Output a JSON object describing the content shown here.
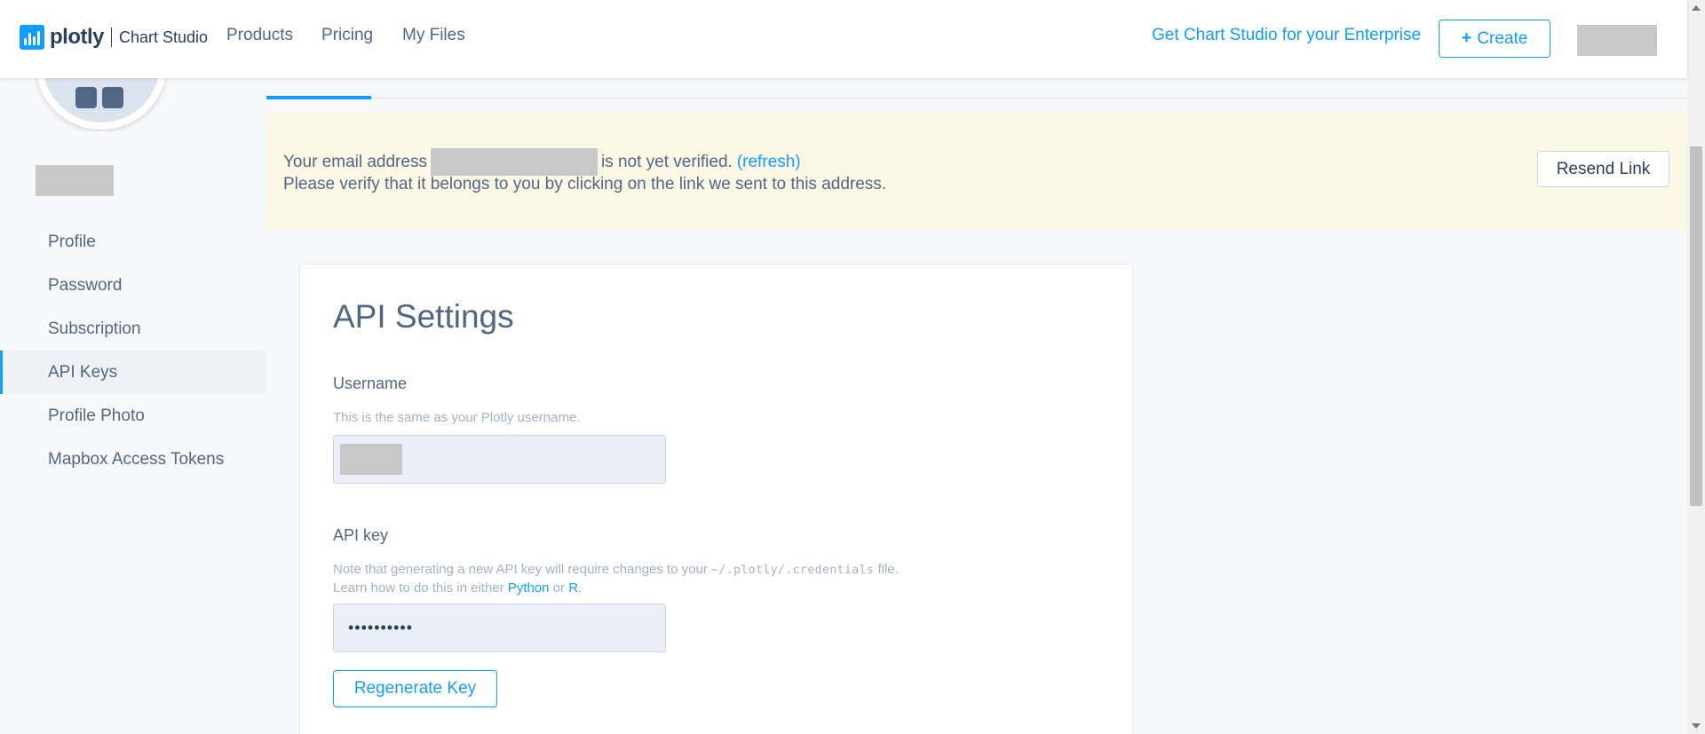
{
  "nav": {
    "logo_text": "plotly",
    "logo_sub": "Chart Studio",
    "links": [
      "Products",
      "Pricing",
      "My Files"
    ],
    "enterprise_link": "Get Chart Studio for your Enterprise",
    "create_label": "Create",
    "create_plus": "+"
  },
  "sidebar": {
    "items": [
      {
        "label": "Profile",
        "active": false
      },
      {
        "label": "Password",
        "active": false
      },
      {
        "label": "Subscription",
        "active": false
      },
      {
        "label": "API Keys",
        "active": true
      },
      {
        "label": "Profile Photo",
        "active": false
      },
      {
        "label": "Mapbox Access Tokens",
        "active": false
      }
    ]
  },
  "banner": {
    "text_before": "Your email address",
    "text_after": "is not yet verified.",
    "refresh_label": "(refresh)",
    "line2": "Please verify that it belongs to you by clicking on the link we sent to this address.",
    "resend_label": "Resend Link"
  },
  "api_settings": {
    "title": "API Settings",
    "username_label": "Username",
    "username_help": "This is the same as your Plotly username.",
    "api_key_label": "API key",
    "api_key_help_before": "Note that generating a new API key will require changes to your",
    "api_key_help_code": "~/.plotly/.credentials",
    "api_key_help_after": "file.",
    "api_key_help_line2": "Learn how to do this in either",
    "python_link": "Python",
    "or_text": "or",
    "r_link": "R",
    "api_key_masked": "••••••••••",
    "regenerate_label": "Regenerate Key"
  },
  "colors": {
    "accent": "#119dff",
    "text": "#506784",
    "banner_bg": "#fdf7e6"
  }
}
